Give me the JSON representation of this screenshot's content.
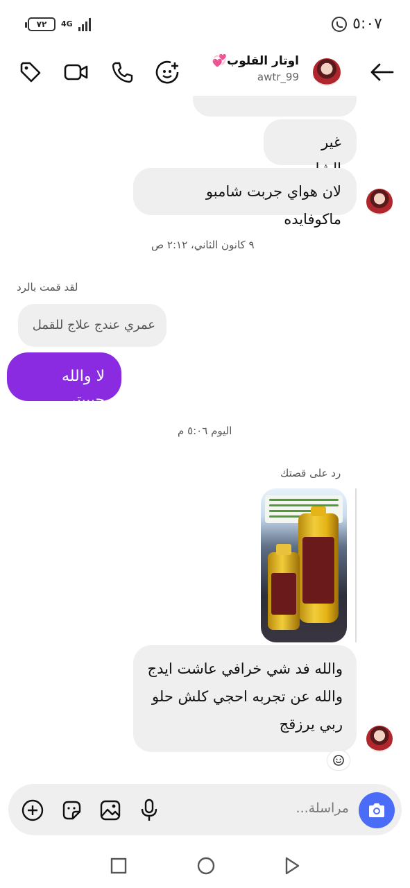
{
  "status_bar": {
    "battery": "٧٢",
    "network": "4G",
    "time": "٥:٠٧"
  },
  "header": {
    "name": "اوتار القلوب💞",
    "username": "awtr_99"
  },
  "messages": {
    "partial_top": "...",
    "m1": "غير الشامبو",
    "m2": "لان هواي جربت شامبو ماكوفايده",
    "ts1": "٩ كانون الثاني، ٢:١٢ ص",
    "reply_label": "لقد قمت بالرد",
    "quoted": "عمري عندج علاج للقمل",
    "sent": "لا والله حبيبتي",
    "ts2": "اليوم ٥:٠٦ م",
    "story_label": "رد على قصتك",
    "story_lines": [
      "والله فد شي خرافي عاشت ايدج",
      "والله عن تجربه احجي كلش حلو",
      "ربي يرزقج"
    ]
  },
  "composer": {
    "placeholder": "مراسلة..."
  },
  "colors": {
    "accent_purple": "#8a2be2",
    "camera_blue": "#4a6cf7",
    "bubble_gray": "#efefef"
  }
}
